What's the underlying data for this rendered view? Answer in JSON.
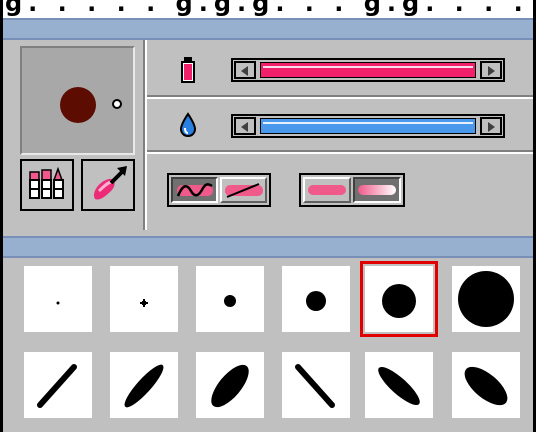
{
  "window": {
    "menu_fragment": "g. . . . . g.g.g. . . g.g. . . ."
  },
  "preview": {
    "color": "#5c0c00"
  },
  "tools": [
    {
      "name": "paint-tubes"
    },
    {
      "name": "brush-arrow"
    }
  ],
  "sliders": [
    {
      "name": "opacity",
      "icon": "paint-tube-icon",
      "color": "#f0206a",
      "value": 1.0
    },
    {
      "name": "wetness",
      "icon": "water-drop-icon",
      "color": "#4a98ec",
      "value": 1.0
    }
  ],
  "mode_groups": [
    {
      "buttons": [
        "freehand",
        "straight-line"
      ],
      "selected": 0
    },
    {
      "buttons": [
        "stroke-solid",
        "stroke-fade"
      ],
      "selected": 1
    }
  ],
  "brushes": {
    "round": [
      "tiny-dot",
      "small-plus",
      "medium-dot",
      "large-dot",
      "xlarge-dot",
      "xxlarge-dot"
    ],
    "angled": [
      "thin-slash",
      "medium-slash",
      "wide-slash",
      "thin-backslash",
      "medium-backslash",
      "wide-backslash"
    ],
    "selected": "xlarge-dot"
  },
  "colors": {
    "accent_pink": "#f0206a",
    "accent_blue": "#4a98ec",
    "selection": "#e00000",
    "titlebar": "#98b0d0"
  }
}
